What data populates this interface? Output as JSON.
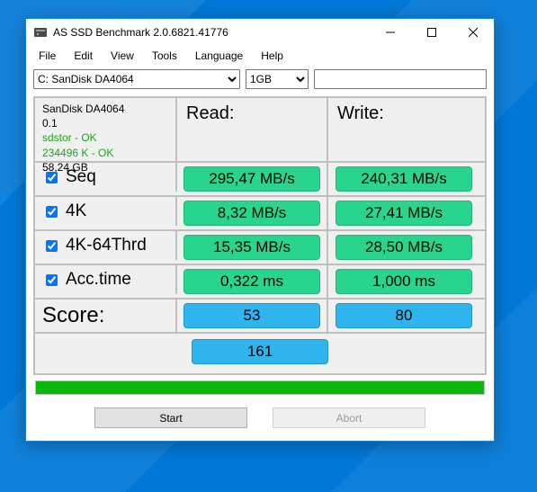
{
  "window": {
    "title": "AS SSD Benchmark 2.0.6821.41776"
  },
  "menu": {
    "file": "File",
    "edit": "Edit",
    "view": "View",
    "tools": "Tools",
    "language": "Language",
    "help": "Help"
  },
  "toolbar": {
    "drive_selected": "C: SanDisk DA4064",
    "size_selected": "1GB",
    "name_value": ""
  },
  "info": {
    "model": "SanDisk DA4064",
    "firmware": "0.1",
    "driver_status": "sdstor - OK",
    "partition_status": "234496 K - OK",
    "capacity": "58,24 GB"
  },
  "headers": {
    "read": "Read:",
    "write": "Write:"
  },
  "tests": {
    "seq": {
      "label": "Seq",
      "checked": true,
      "read": "295,47 MB/s",
      "write": "240,31 MB/s"
    },
    "k4": {
      "label": "4K",
      "checked": true,
      "read": "8,32 MB/s",
      "write": "27,41 MB/s"
    },
    "k4t": {
      "label": "4K-64Thrd",
      "checked": true,
      "read": "15,35 MB/s",
      "write": "28,50 MB/s"
    },
    "acc": {
      "label": "Acc.time",
      "checked": true,
      "read": "0,322 ms",
      "write": "1,000 ms"
    }
  },
  "score": {
    "label": "Score:",
    "read": "53",
    "write": "80",
    "total": "161"
  },
  "buttons": {
    "start": "Start",
    "abort": "Abort"
  }
}
